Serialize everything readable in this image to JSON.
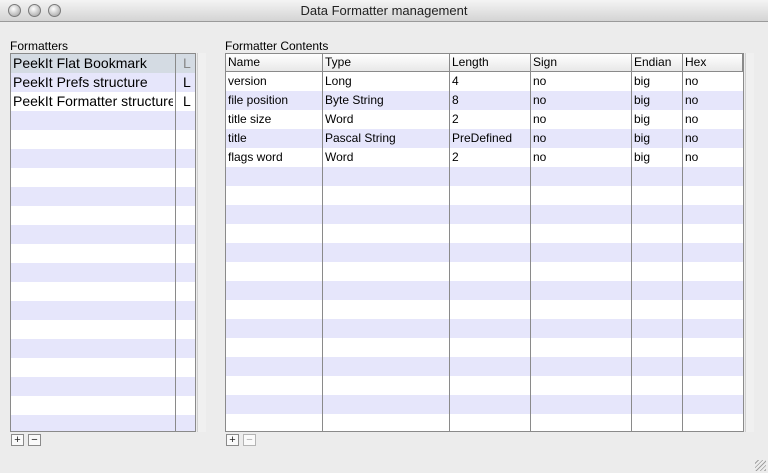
{
  "window": {
    "title": "Data Formatter management"
  },
  "formatters": {
    "label": "Formatters",
    "items": [
      {
        "name": "PeekIt Flat Bookmark",
        "kind": "L",
        "selected": true
      },
      {
        "name": "PeekIt Prefs structure",
        "kind": "L",
        "selected": false
      },
      {
        "name": "PeekIt Formatter structure",
        "kind": "L",
        "selected": false
      }
    ],
    "add_label": "+",
    "remove_label": "−"
  },
  "contents": {
    "label": "Formatter Contents",
    "columns": [
      "Name",
      "Type",
      "Length",
      "Sign",
      "Endian",
      "Hex"
    ],
    "rows": [
      [
        "version",
        "Long",
        "4",
        "no",
        "big",
        "no"
      ],
      [
        "file position",
        "Byte String",
        "8",
        "no",
        "big",
        "no"
      ],
      [
        "title size",
        "Word",
        "2",
        "no",
        "big",
        "no"
      ],
      [
        "title",
        "Pascal String",
        "PreDefined",
        "no",
        "big",
        "no"
      ],
      [
        "flags word",
        "Word",
        "2",
        "no",
        "big",
        "no"
      ]
    ],
    "add_label": "+",
    "remove_label": "−"
  }
}
